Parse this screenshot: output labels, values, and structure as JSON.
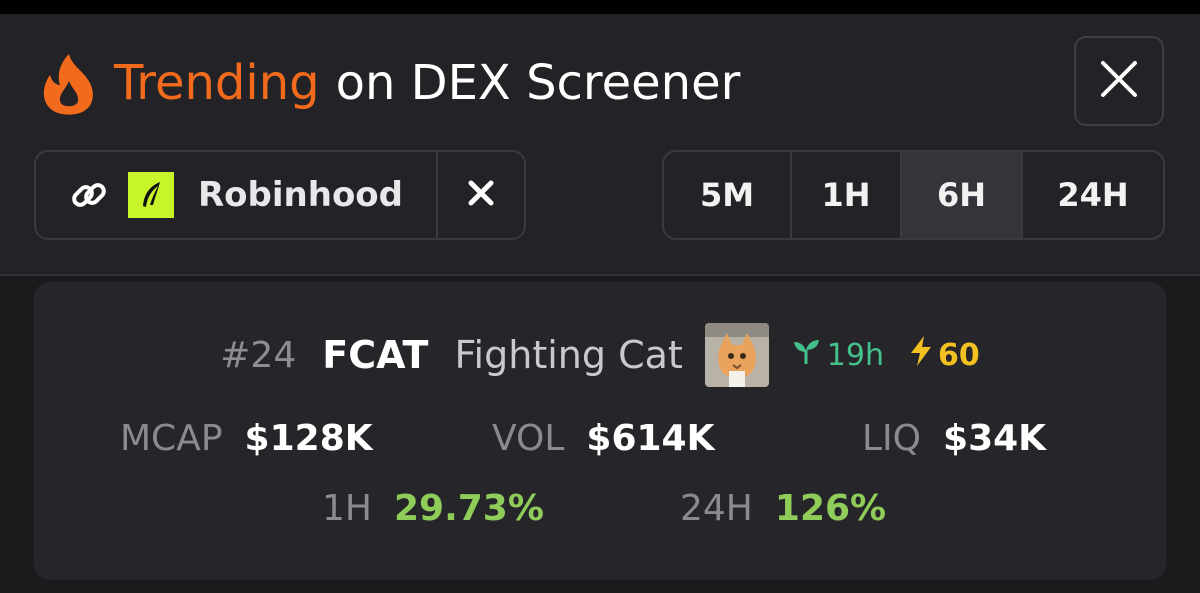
{
  "header": {
    "title_accent": "Trending",
    "title_rest": "on DEX Screener",
    "icons": {
      "title": "fire-icon",
      "close": "close-icon"
    }
  },
  "filter": {
    "label": "Robinhood",
    "icons": {
      "link": "link-icon",
      "logo": "robinhood-feather-logo",
      "remove": "remove-icon"
    }
  },
  "timeframes": [
    {
      "label": "5M",
      "active": false
    },
    {
      "label": "1H",
      "active": false
    },
    {
      "label": "6H",
      "active": true
    },
    {
      "label": "24H",
      "active": false
    }
  ],
  "token": {
    "rank": "#24",
    "symbol": "FCAT",
    "name": "Fighting Cat",
    "age": "19h",
    "boosts": "60",
    "stats": {
      "mcap_label": "MCAP",
      "mcap_value": "$128K",
      "vol_label": "VOL",
      "vol_value": "$614K",
      "liq_label": "LIQ",
      "liq_value": "$34K"
    },
    "changes": {
      "h1_label": "1H",
      "h1_value": "29.73%",
      "h24_label": "24H",
      "h24_value": "126%"
    }
  },
  "colors": {
    "accent": "#f26b1d",
    "positive": "#8fcc5a",
    "age_green": "#44c08a",
    "boost_yellow": "#f2c021",
    "robinhood_green": "#c8f52a"
  }
}
